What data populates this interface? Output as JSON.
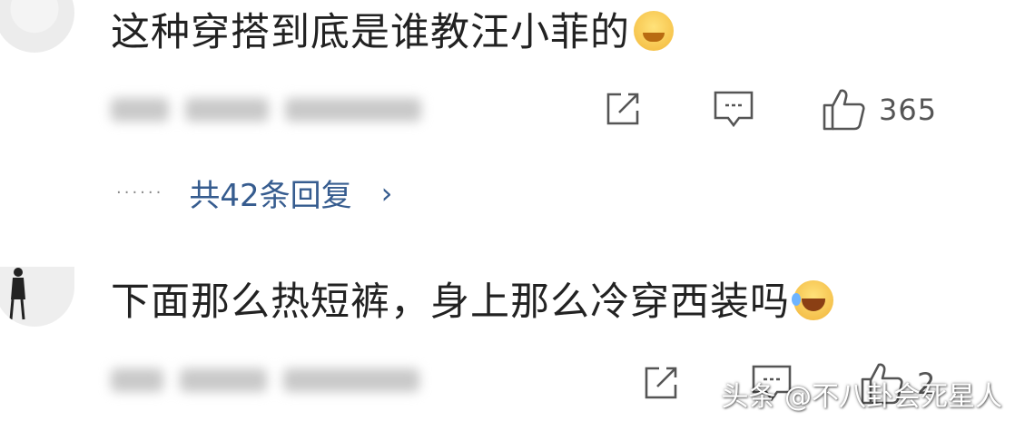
{
  "comments": [
    {
      "avatar": "user-avatar",
      "text": "这种穿搭到底是谁教汪小菲的",
      "emoji": "grinning-face-emoji",
      "like_count": "365",
      "replies_label": "共42条回复"
    },
    {
      "avatar": "user-avatar",
      "text": "下面那么热短裤，身上那么冷穿西装吗",
      "emoji": "laughing-tears-emoji",
      "like_count": "2"
    }
  ],
  "icons": {
    "share": "share-icon",
    "comment": "comment-icon",
    "like": "thumbs-up-icon",
    "chevron": "chevron-right-icon"
  },
  "watermark": "头条 @不八卦会死星人",
  "colors": {
    "reply_link": "#365c8f",
    "text": "#222222",
    "icon": "#555555"
  }
}
